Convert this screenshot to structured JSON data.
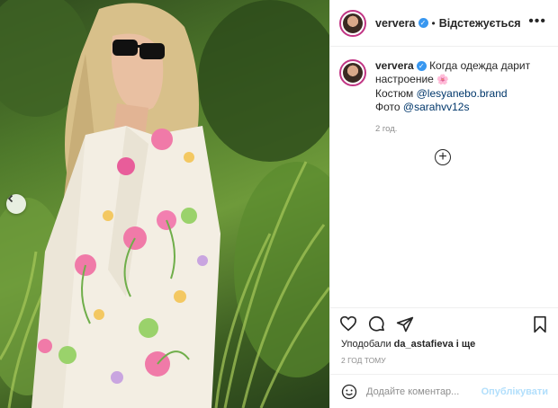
{
  "post": {
    "username": "ververa",
    "follow_separator": "•",
    "follow_state": "Відстежується",
    "caption": {
      "username": "ververa",
      "line1": "Когда одежда дарит настроение",
      "flower_icon": "🌸",
      "line2_prefix": "Костюм",
      "line2_mention": "@lesyanebo.brand",
      "line3_prefix": "Фото",
      "line3_mention": "@sarahvv12s"
    },
    "time_ago": "2 год.",
    "likes_prefix": "Уподобали",
    "likes_user": "da_astafieva",
    "likes_suffix": "і ще",
    "posted_ago": "2 год тому",
    "comment_placeholder": "Додайте коментар...",
    "publish_label": "Опублікувати"
  },
  "icons": {
    "verified": "verified-badge-icon",
    "more": "more-options-icon",
    "nav_prev": "chevron-left-icon",
    "add": "plus-circle-icon",
    "like": "heart-icon",
    "comment": "comment-icon",
    "share": "send-icon",
    "save": "bookmark-icon",
    "emoji": "emoji-icon"
  },
  "colors": {
    "verified": "#3897f0",
    "link": "#00376b",
    "muted": "#8e8e8e",
    "publish_disabled": "#b2dffc",
    "flower": "#e75aa0"
  }
}
